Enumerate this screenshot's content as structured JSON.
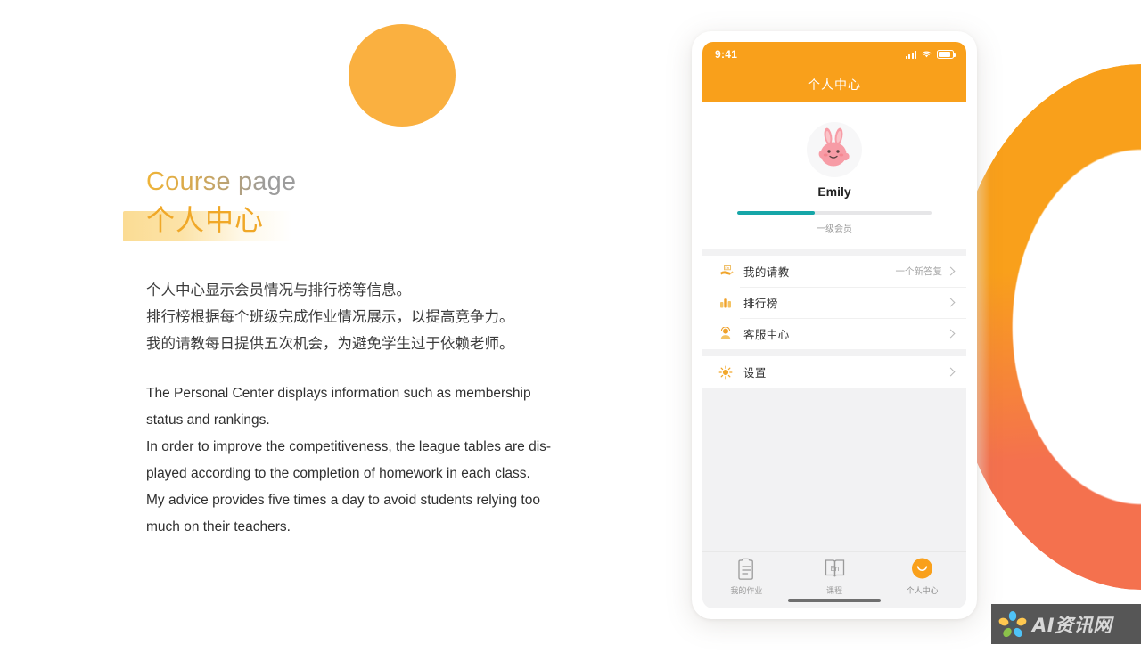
{
  "page": {
    "title_en": "Course page",
    "title_cn": "个人中心",
    "body_cn": [
      "个人中心显示会员情况与排行榜等信息。",
      "排行榜根据每个班级完成作业情况展示，以提高竞争力。",
      "我的请教每日提供五次机会，为避免学生过于依赖老师。"
    ],
    "body_en": [
      "The Personal Center displays information such as membership",
      "status and rankings.",
      "In order to improve the competitiveness, the league tables are dis-",
      "played according to the completion of homework in each class.",
      "My advice provides five times a day to avoid students relying too",
      "much on their teachers."
    ]
  },
  "colors": {
    "brand_orange": "#F9A01B",
    "circle_amber": "#FAB040",
    "ring_top": "#F9A01B",
    "ring_bottom": "#F4714E",
    "progress_teal": "#16A6A8",
    "title_gold": "#F0A828",
    "highlight_yellow": "#FBDC94"
  },
  "phone": {
    "status": {
      "time": "9:41",
      "signal_icon": "signal-bars-icon",
      "wifi_icon": "wifi-icon",
      "battery_icon": "battery-icon"
    },
    "navbar": {
      "title": "个人中心"
    },
    "profile": {
      "avatar_icon": "bunny-avatar-icon",
      "username": "Emily",
      "progress_percent": 40,
      "level_label": "一级会员"
    },
    "menu_groups": [
      {
        "items": [
          {
            "icon": "teaching-hand-icon",
            "label": "我的请教",
            "meta": "一个新答复",
            "chevron": "chevron-right-icon"
          },
          {
            "icon": "bar-chart-icon",
            "label": "排行榜",
            "meta": "",
            "chevron": "chevron-right-icon"
          },
          {
            "icon": "customer-service-icon",
            "label": "客服中心",
            "meta": "",
            "chevron": "chevron-right-icon"
          }
        ]
      },
      {
        "items": [
          {
            "icon": "sun-settings-icon",
            "label": "设置",
            "meta": "",
            "chevron": "chevron-right-icon"
          }
        ]
      }
    ],
    "tabs": [
      {
        "icon": "clipboard-icon",
        "label": "我的作业",
        "active": false
      },
      {
        "icon": "english-book-icon",
        "label": "课程",
        "active": false
      },
      {
        "icon": "smiley-profile-icon",
        "label": "个人中心",
        "active": true
      }
    ]
  },
  "watermark": {
    "text": "AI资讯网",
    "logo_icon": "flower-logo-icon"
  }
}
